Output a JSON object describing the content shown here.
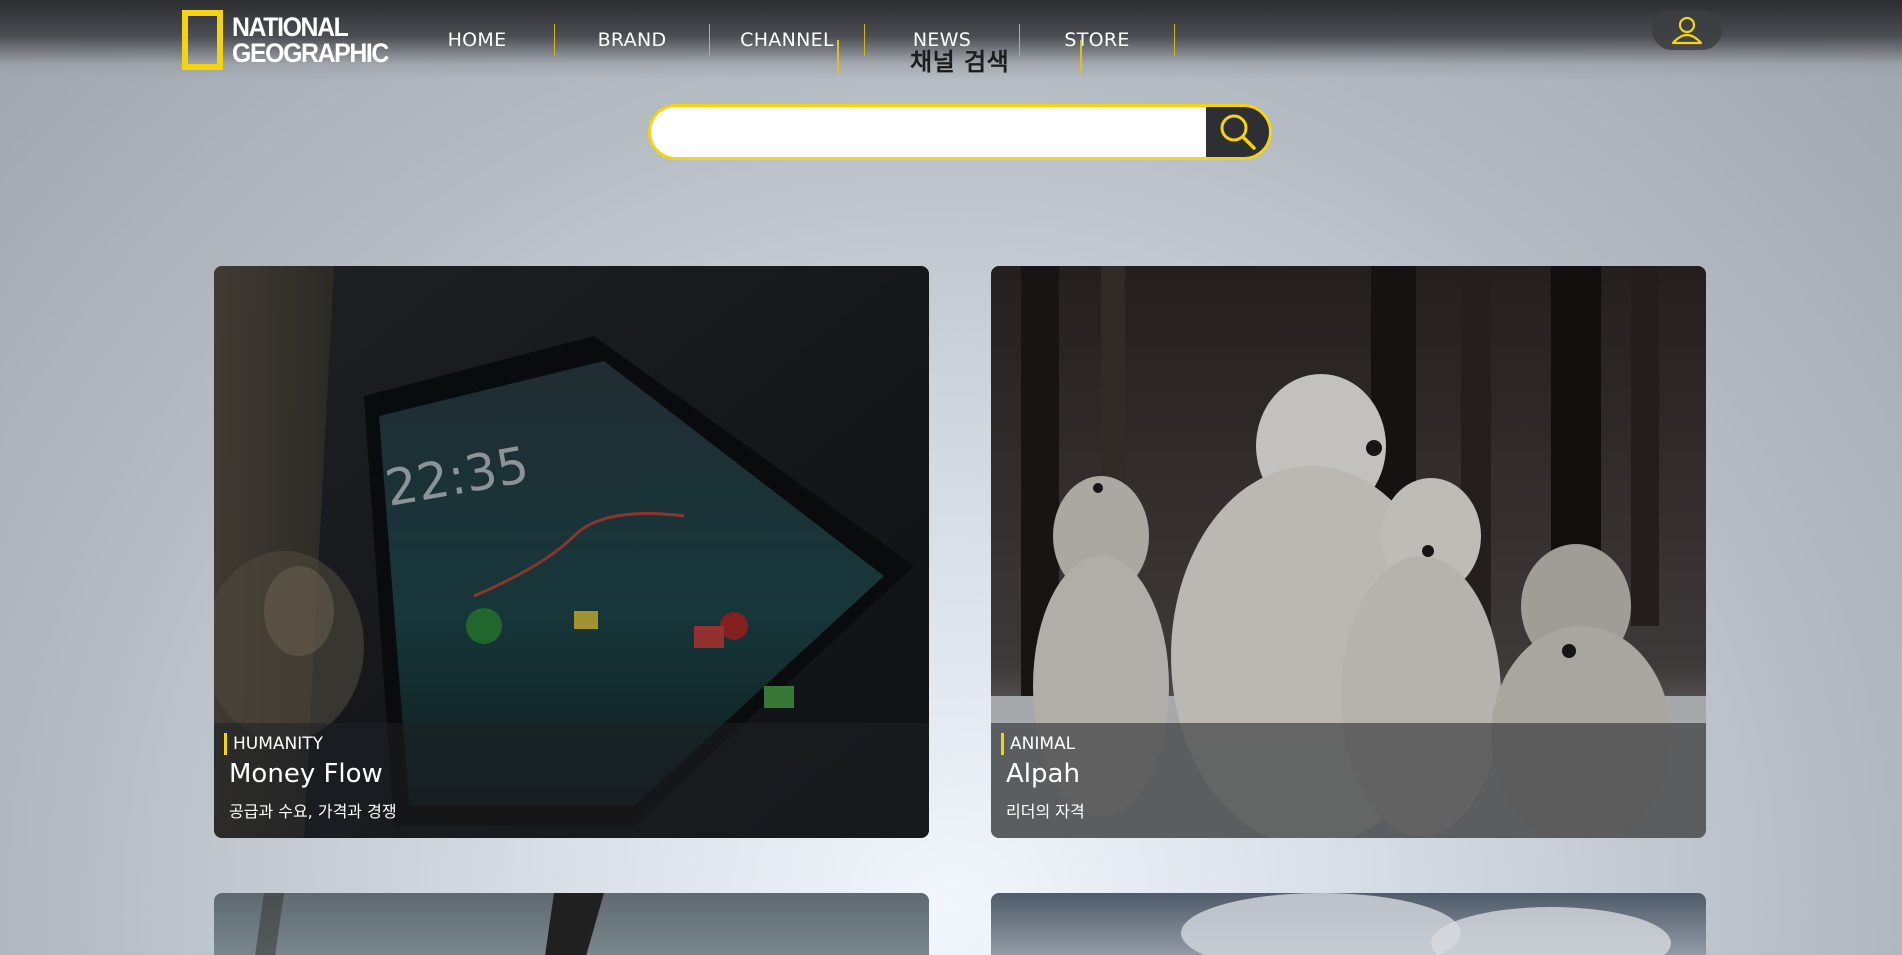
{
  "header": {
    "logo_line1": "NATIONAL",
    "logo_line2": "GEOGRAPHIC",
    "nav": [
      "HOME",
      "BRAND",
      "CHANNEL",
      "NEWS",
      "STORE"
    ],
    "channel_title": "채널 검색"
  },
  "search": {
    "placeholder": ""
  },
  "cards": [
    {
      "category": "HUMANITY",
      "title": "Money Flow",
      "desc": "공급과 수요, 가격과 경쟁"
    },
    {
      "category": "ANIMAL",
      "title": "Alpah",
      "desc": "리더의 자격"
    }
  ],
  "colors": {
    "accent": "#f5d313",
    "dark": "#2d2f33"
  },
  "icons": {
    "user": "user-icon",
    "search": "search-icon"
  }
}
